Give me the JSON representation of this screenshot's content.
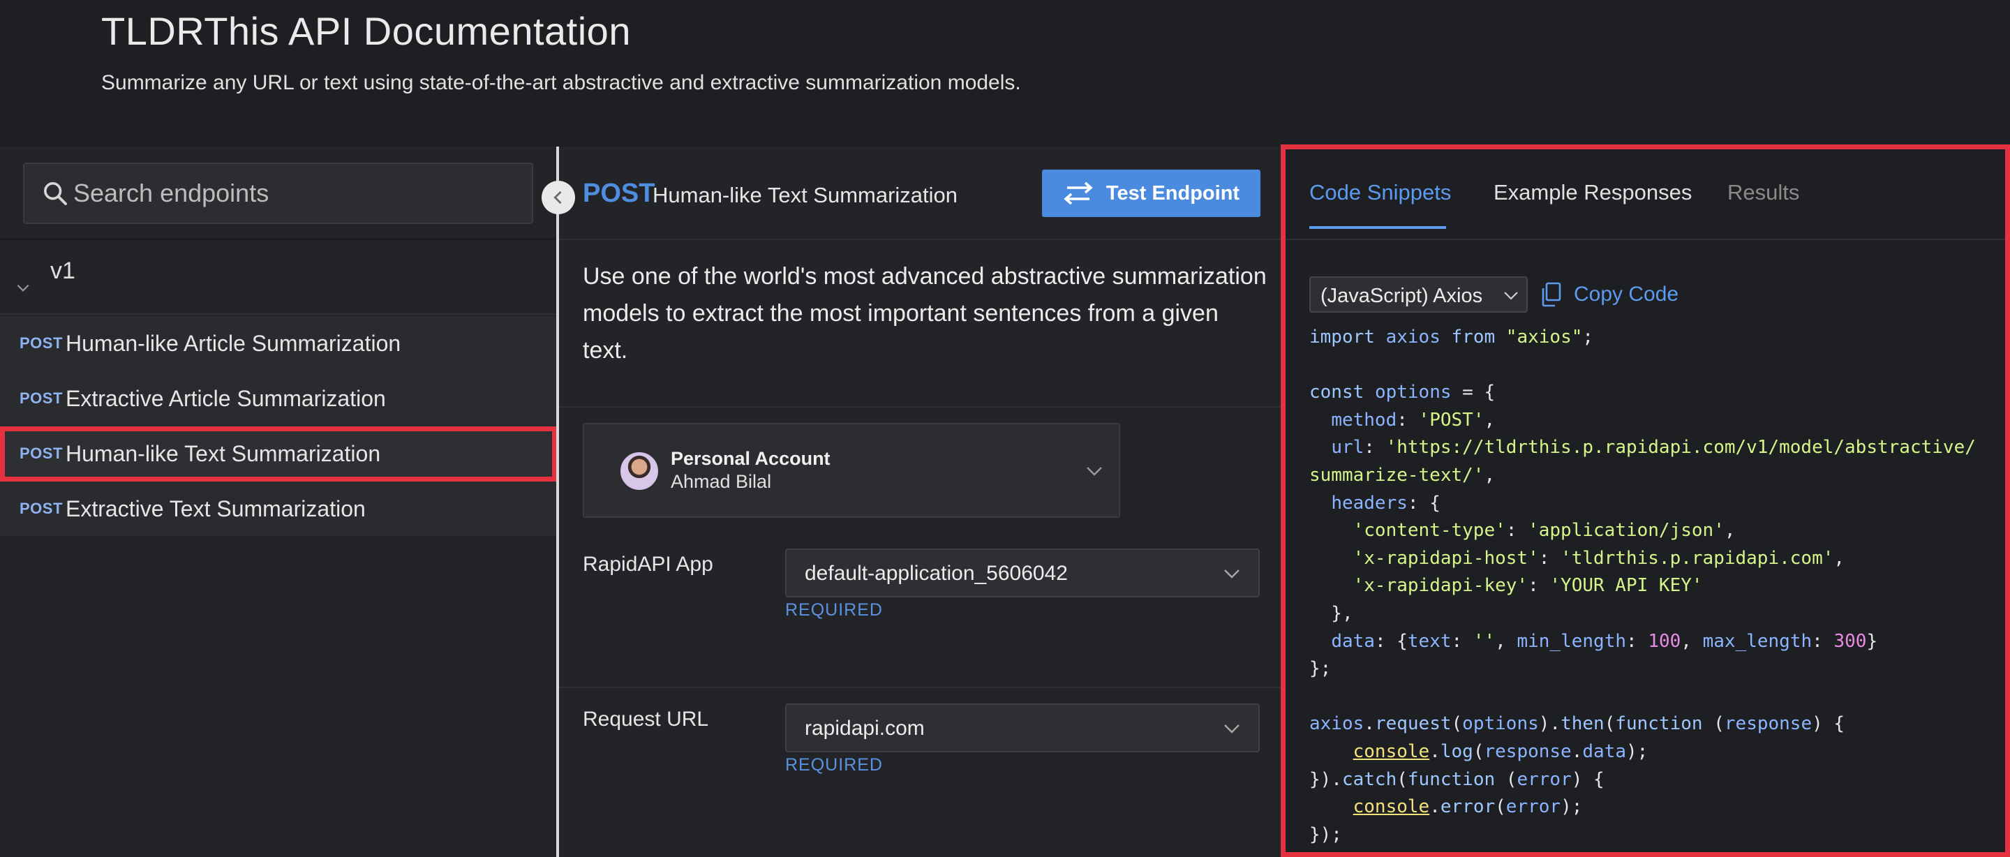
{
  "header": {
    "title": "TLDRThis API Documentation",
    "subtitle": "Summarize any URL or text using state-of-the-art abstractive and extractive summarization models."
  },
  "sidebar": {
    "search_placeholder": "Search endpoints",
    "version": "v1",
    "endpoints": [
      {
        "method": "POST",
        "name": "Human-like Article Summarization"
      },
      {
        "method": "POST",
        "name": "Extractive Article Summarization"
      },
      {
        "method": "POST",
        "name": "Human-like Text Summarization",
        "active": true
      },
      {
        "method": "POST",
        "name": "Extractive Text Summarization"
      }
    ]
  },
  "endpoint": {
    "method": "POST",
    "name": "Human-like Text Summarization",
    "test_button": "Test Endpoint",
    "description": "Use one of the world's most advanced abstractive summarization models to extract the most important sentences from a given text.",
    "account": {
      "title": "Personal Account",
      "name": "Ahmad Bilal"
    },
    "rapidapi_app": {
      "label": "RapidAPI App",
      "value": "default-application_5606042",
      "required": "REQUIRED"
    },
    "request_url": {
      "label": "Request URL",
      "value": "rapidapi.com",
      "required": "REQUIRED"
    }
  },
  "right_panel": {
    "tabs": [
      "Code Snippets",
      "Example Responses",
      "Results"
    ],
    "active_tab": "Code Snippets",
    "language": "(JavaScript) Axios",
    "copy_label": "Copy Code"
  },
  "colors": {
    "accent": "#4a8be0",
    "highlight_border": "#e63140",
    "background": "#1e1f22"
  }
}
